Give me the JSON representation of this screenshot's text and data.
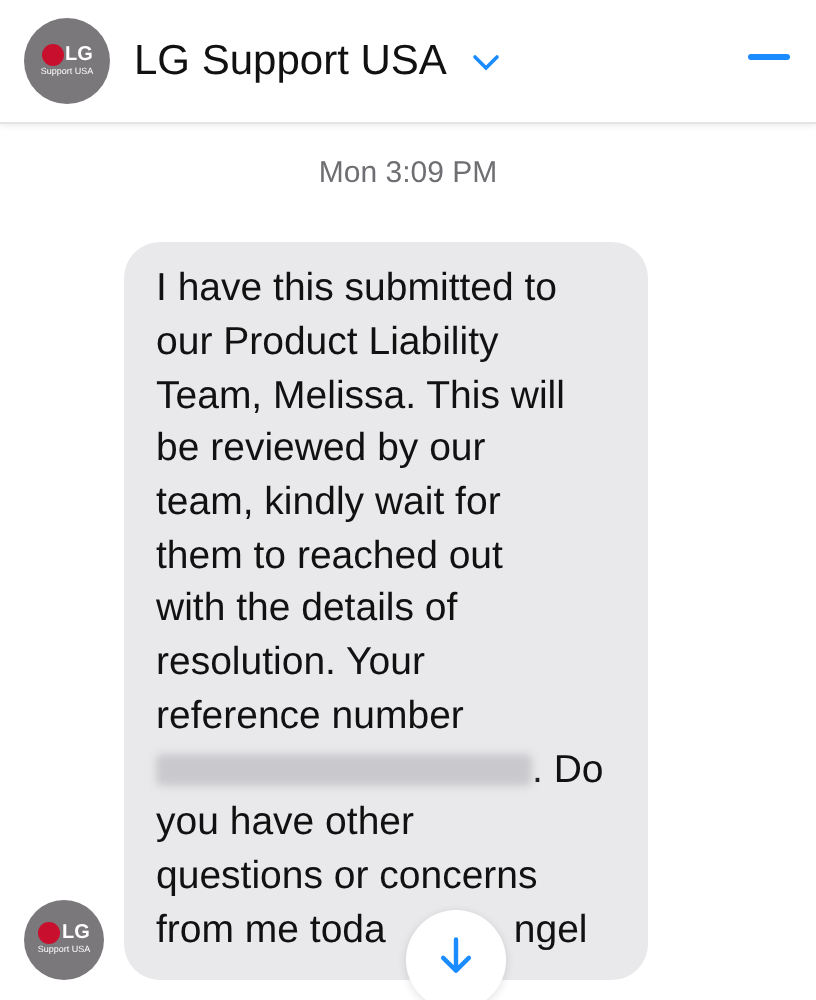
{
  "header": {
    "avatar": {
      "logo": "LG",
      "caption": "Support USA"
    },
    "title": "LG Support USA"
  },
  "timestamp": "Mon 3:09 PM",
  "message": {
    "avatar": {
      "logo": "LG",
      "caption": "Support USA"
    },
    "lines": [
      [
        {
          "kind": "text",
          "text": "I have this submitted to"
        }
      ],
      [
        {
          "kind": "text",
          "text": "our Product Liability"
        }
      ],
      [
        {
          "kind": "text",
          "text": "Team, Melissa. This will"
        }
      ],
      [
        {
          "kind": "text",
          "text": "be reviewed by our"
        }
      ],
      [
        {
          "kind": "text",
          "text": "team, kindly wait for"
        }
      ],
      [
        {
          "kind": "text",
          "text": "them to reached out"
        }
      ],
      [
        {
          "kind": "text",
          "text": "with the details of"
        }
      ],
      [
        {
          "kind": "text",
          "text": "resolution. Your"
        }
      ],
      [
        {
          "kind": "text",
          "text": "reference number"
        }
      ],
      [
        {
          "kind": "redacted"
        },
        {
          "kind": "text",
          "text": ". Do"
        }
      ],
      [
        {
          "kind": "text",
          "text": "you have other"
        }
      ],
      [
        {
          "kind": "text",
          "text": "questions or concerns"
        }
      ],
      [
        {
          "kind": "text",
          "text": "from me toda"
        },
        {
          "kind": "gap"
        },
        {
          "kind": "text",
          "text": "ngel"
        }
      ]
    ]
  }
}
